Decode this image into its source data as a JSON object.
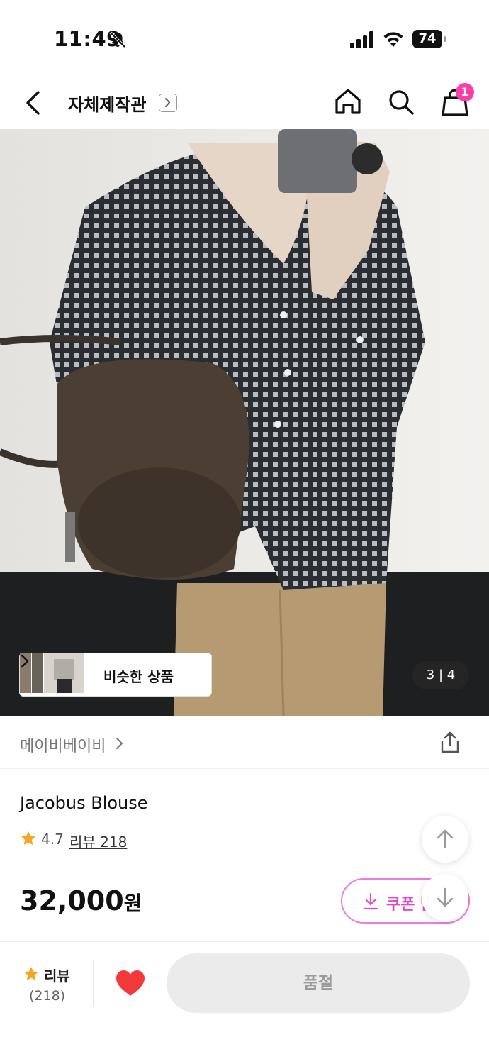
{
  "status_bar": {
    "time": "11:49",
    "battery": "74"
  },
  "nav": {
    "title": "자체제작관",
    "cart_count": "1"
  },
  "hero": {
    "similar_label": "비슷한 상품",
    "pager": "3 | 4"
  },
  "brand": {
    "name": "메이비베이비"
  },
  "product": {
    "name": "Jacobus Blouse",
    "rating": "4.7",
    "review_link": "리뷰 218",
    "price": "32,000",
    "price_unit": "원",
    "coupon_label": "쿠폰 받기"
  },
  "bottom_bar": {
    "review_label": "리뷰",
    "review_count": "(218)",
    "soldout_label": "품절"
  },
  "colors": {
    "accent_pink": "#e547c7",
    "badge_pink": "#ff3ca8",
    "heart_red": "#f23a3a",
    "star_orange": "#f5a623"
  }
}
